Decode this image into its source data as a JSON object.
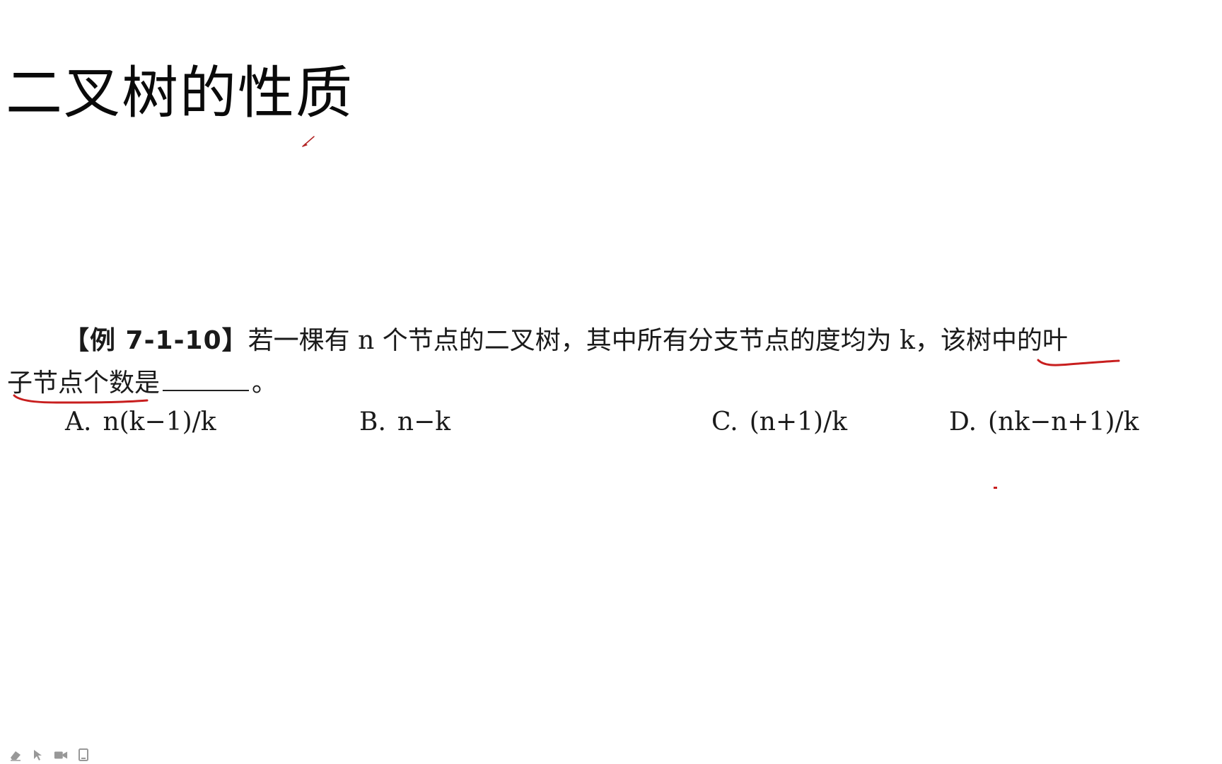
{
  "slide": {
    "title": "二叉树的性质"
  },
  "question": {
    "label": "【例 7-1-10】",
    "line1_text": "若一棵有 n 个节点的二叉树，其中所有分支节点的度均为 k，该树中的叶",
    "line2_text": "子节点个数是",
    "line2_end": "。"
  },
  "options": [
    {
      "letter": "A.",
      "text": "n(k−1)/k"
    },
    {
      "letter": "B.",
      "text": "n−k"
    },
    {
      "letter": "C.",
      "text": "(n+1)/k"
    },
    {
      "letter": "D.",
      "text": "(nk−n+1)/k"
    }
  ],
  "annotations": {
    "ink_color": "#c81e1e",
    "pen_cursor_color": "#b22222"
  },
  "toolbar": {
    "tools": [
      {
        "icon": "eraser-icon"
      },
      {
        "icon": "pointer-icon"
      },
      {
        "icon": "camera-icon"
      },
      {
        "icon": "tablet-icon"
      }
    ]
  }
}
